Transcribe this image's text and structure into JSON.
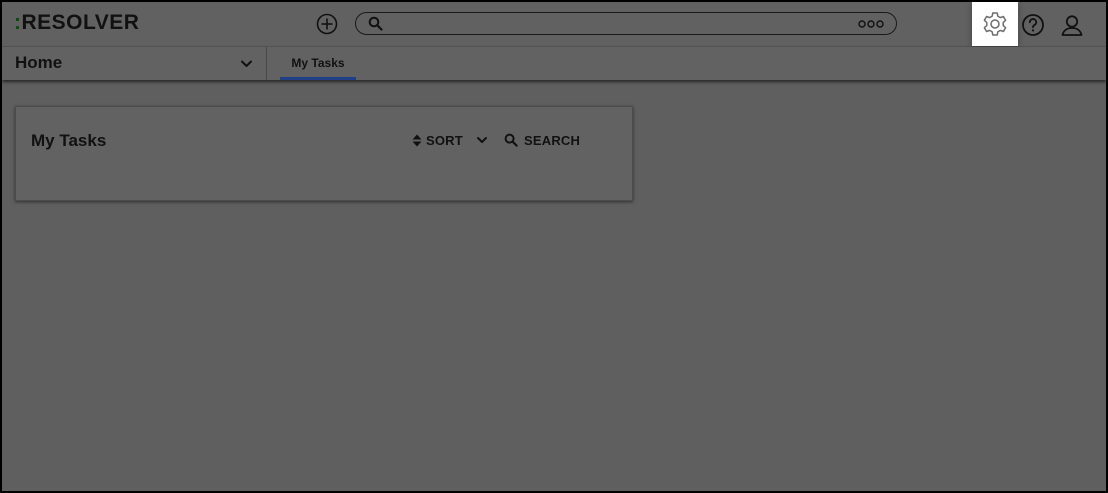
{
  "app": {
    "logo_colon": ":",
    "logo_text": "RESOLVER"
  },
  "header": {
    "icons": [
      "plus-circle-icon",
      "search-icon",
      "more-icon",
      "gear-icon",
      "help-icon",
      "user-icon"
    ],
    "search_value": ""
  },
  "nav": {
    "home_label": "Home",
    "tabs": [
      {
        "label": "My Tasks",
        "active": true
      }
    ]
  },
  "card": {
    "title": "My Tasks",
    "sort_label": "SORT",
    "search_label": "SEARCH"
  },
  "colors": {
    "overlay": "#5f5f5f",
    "active_tab_underline": "#1f3f87",
    "highlight": "#ffffff"
  }
}
